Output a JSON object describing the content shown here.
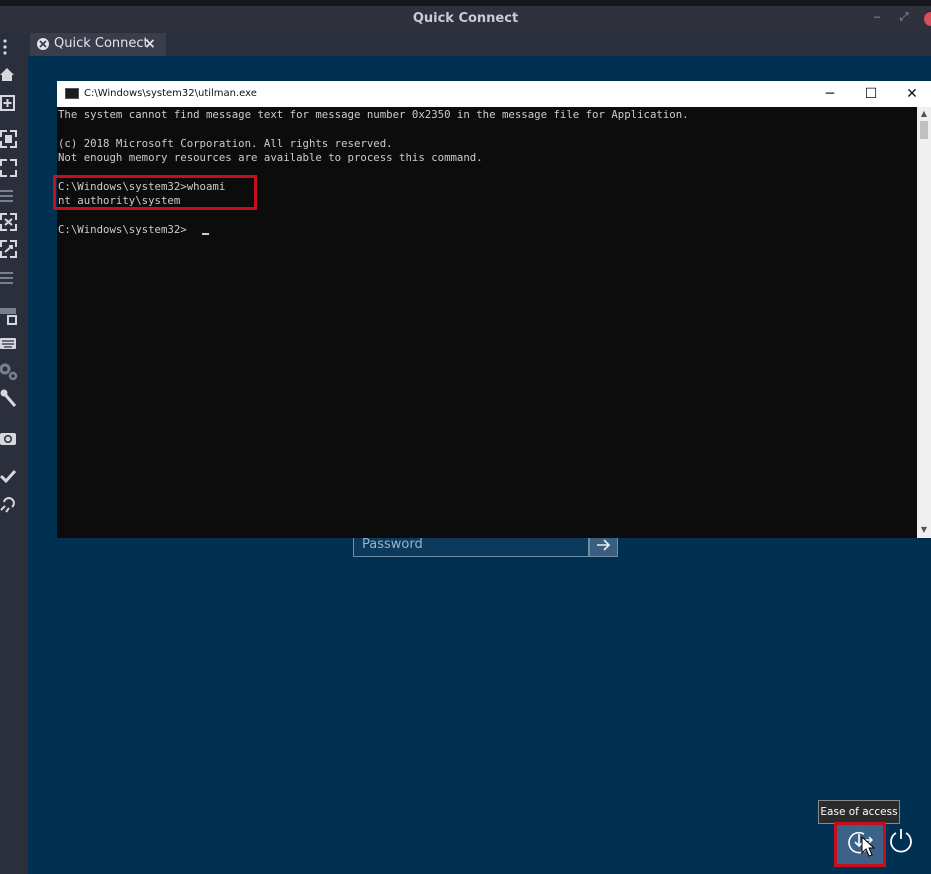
{
  "app": {
    "title": "Quick Connect",
    "tab_label": "Quick Connect",
    "tab_close": "×"
  },
  "console": {
    "title": "C:\\Windows\\system32\\utilman.exe",
    "minimize": "─",
    "maximize": "☐",
    "close": "✕",
    "lines": [
      "The system cannot find message text for message number 0x2350 in the message file for Application.",
      "",
      "(c) 2018 Microsoft Corporation. All rights reserved.",
      "Not enough memory resources are available to process this command.",
      "",
      "C:\\Windows\\system32>whoami",
      "nt authority\\system",
      "",
      "C:\\Windows\\system32>"
    ]
  },
  "login": {
    "password_placeholder": "Password"
  },
  "tooltip": "Ease of access",
  "icons": {
    "tab": "quick-connect-icon",
    "ease": "ease-of-access-icon",
    "power": "power-icon",
    "submit": "arrow-right-icon"
  },
  "colors": {
    "remote_background": "#003052",
    "console_background": "#0c0c0c",
    "console_text": "#cccccc",
    "highlight": "#c4101e",
    "toolbar_background": "#2b2e3b"
  }
}
